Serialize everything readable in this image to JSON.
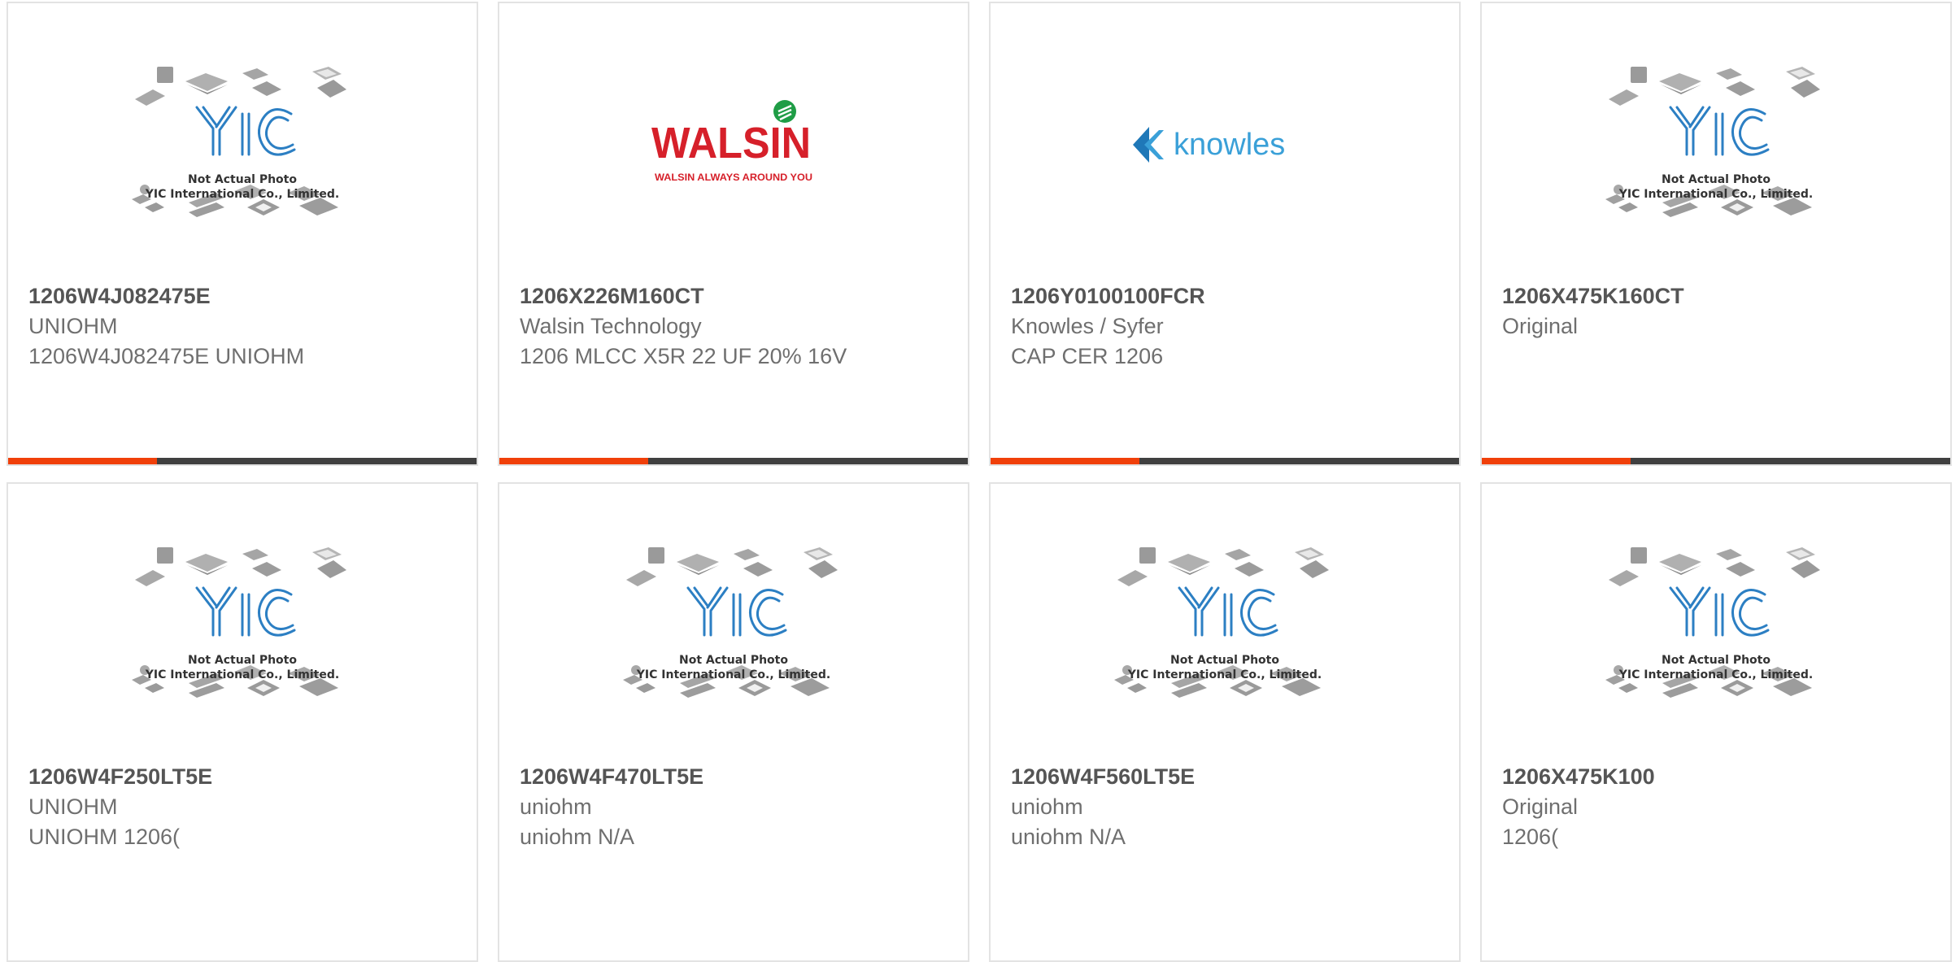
{
  "placeholder_image": {
    "line1": "Not Actual Photo",
    "line2": "YIC International Co., Limited.",
    "logo_text": "YIC"
  },
  "brand_logos": {
    "walsin": {
      "wordmark": "WALSIN",
      "tagline": "WALSIN ALWAYS AROUND YOU"
    },
    "knowles": {
      "wordmark": "knowles"
    }
  },
  "colors": {
    "accent": "#f0400a",
    "bar_dark": "#404040",
    "part_number": "#555555",
    "text": "#6f6f6f",
    "card_border": "#e3e3e3",
    "yic_blue": "#2c7fc3",
    "walsin_red": "#d6202a",
    "walsin_green": "#1f9d46",
    "knowles_blue": "#3aa0d8"
  },
  "products": [
    {
      "part_number": "1206W4J082475E",
      "manufacturer": "UNIOHM",
      "description": "1206W4J082475E UNIOHM",
      "image": "yic-placeholder"
    },
    {
      "part_number": "1206X226M160CT",
      "manufacturer": "Walsin Technology",
      "description": "1206 MLCC X5R 22 UF 20% 16V",
      "image": "walsin-logo"
    },
    {
      "part_number": "1206Y0100100FCR",
      "manufacturer": "Knowles / Syfer",
      "description": "CAP CER 1206",
      "image": "knowles-logo"
    },
    {
      "part_number": "1206X475K160CT",
      "manufacturer": "Original",
      "description": "",
      "image": "yic-placeholder"
    },
    {
      "part_number": "1206W4F250LT5E",
      "manufacturer": "UNIOHM",
      "description": "UNIOHM 1206(",
      "image": "yic-placeholder"
    },
    {
      "part_number": "1206W4F470LT5E",
      "manufacturer": "uniohm",
      "description": "uniohm N/A",
      "image": "yic-placeholder"
    },
    {
      "part_number": "1206W4F560LT5E",
      "manufacturer": "uniohm",
      "description": "uniohm N/A",
      "image": "yic-placeholder"
    },
    {
      "part_number": "1206X475K100",
      "manufacturer": "Original",
      "description": "1206(",
      "image": "yic-placeholder"
    }
  ]
}
